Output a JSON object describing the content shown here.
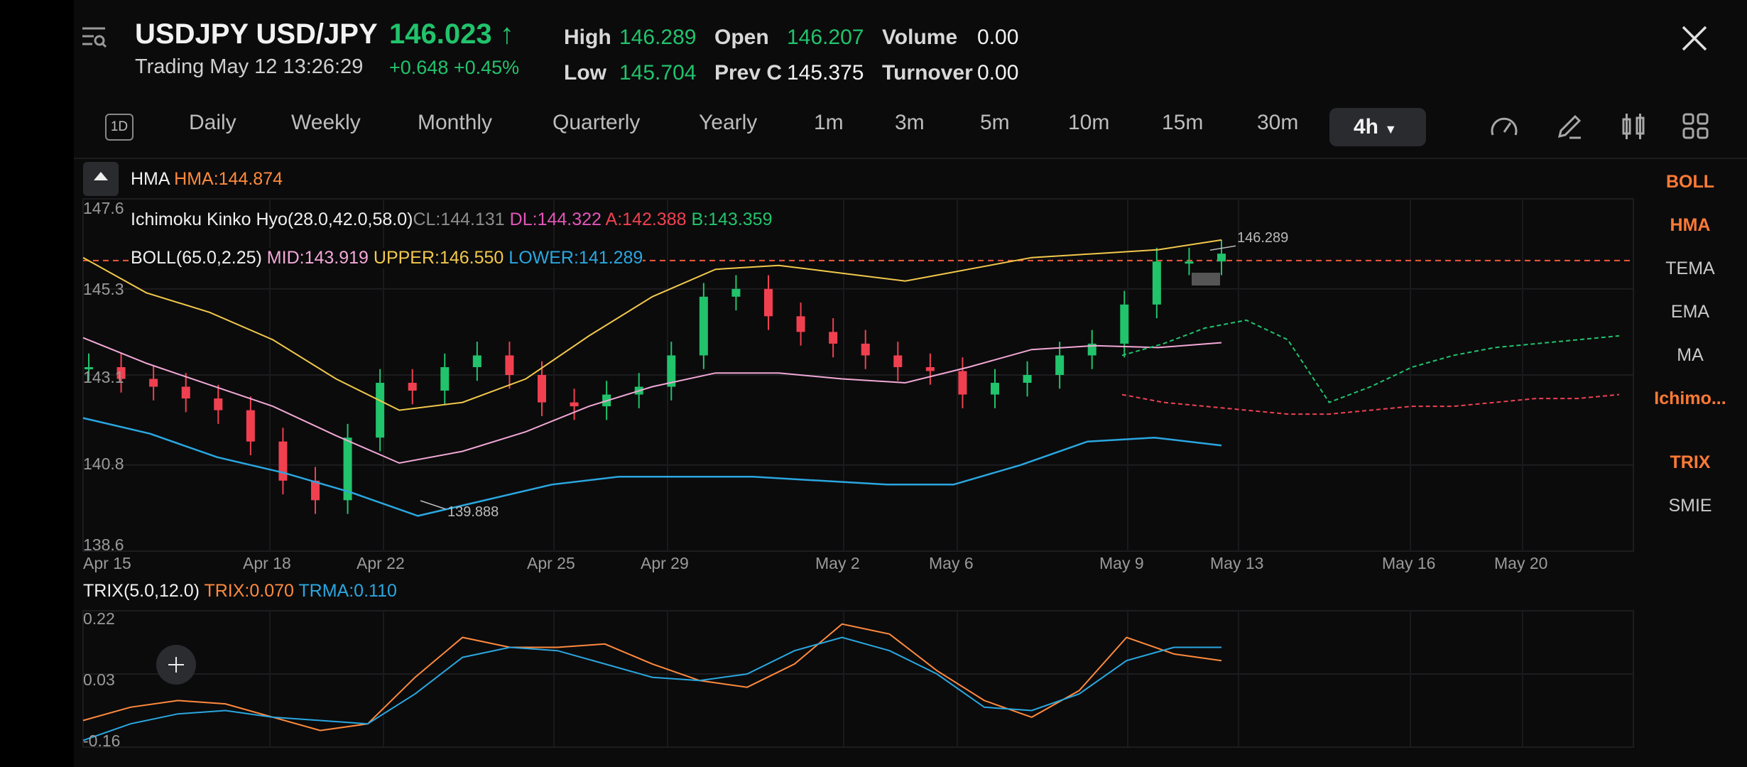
{
  "header": {
    "symbol": "USDJPY USD/JPY",
    "price": "146.023",
    "state": "Trading May 12 13:26:29",
    "change": "+0.648 +0.45%",
    "stats": {
      "high_label": "High",
      "high": "146.289",
      "low_label": "Low",
      "low": "145.704",
      "open_label": "Open",
      "open": "146.207",
      "prevc_label": "Prev C",
      "prevc": "145.375",
      "volume_label": "Volume",
      "volume": "0.00",
      "turnover_label": "Turnover",
      "turnover": "0.00"
    }
  },
  "toolbar": {
    "badge": "1D",
    "periods": [
      "Daily",
      "Weekly",
      "Monthly",
      "Quarterly",
      "Yearly",
      "1m",
      "3m",
      "5m",
      "10m",
      "15m",
      "30m"
    ],
    "active_period": "4h"
  },
  "indicators_side": [
    "BOLL",
    "HMA",
    "TEMA",
    "EMA",
    "MA",
    "Ichimo...",
    "TRIX",
    "SMIE"
  ],
  "legends": {
    "hma_name": "HMA",
    "hma_val": "HMA:144.874",
    "ichi_name": "Ichimoku Kinko Hyo(28.0,42.0,58.0)",
    "ichi_cl": "CL:144.131",
    "ichi_dl": "DL:144.322",
    "ichi_a": "A:142.388",
    "ichi_b": "B:143.359",
    "boll_name": "BOLL(65.0,2.25)",
    "boll_mid": "MID:143.919",
    "boll_upper": "UPPER:146.550",
    "boll_lower": "LOWER:141.289",
    "trix_name": "TRIX(5.0,12.0)",
    "trix_val": "TRIX:0.070",
    "trma_val": "TRMA:0.110"
  },
  "axes": {
    "main_y": [
      "147.6",
      "145.3",
      "143.1",
      "140.8",
      "138.6"
    ],
    "x_dates": [
      "Apr 15",
      "Apr 18",
      "Apr 22",
      "Apr 25",
      "Apr 29",
      "May 2",
      "May 6",
      "May 9",
      "May 13",
      "May 16",
      "May 20"
    ],
    "sub_y": [
      "0.22",
      "0.03",
      "-0.16"
    ],
    "high_mark": "146.289",
    "low_mark": "139.888"
  },
  "colors": {
    "up": "#21c36b",
    "down": "#f04050",
    "orange": "#ff8a3d",
    "yellow": "#f2c84b",
    "blue": "#2aa7e0",
    "pink": "#e255b8",
    "gray": "#8c8c8c"
  },
  "chart_data": [
    {
      "type": "candlestick",
      "title": "",
      "ylim": [
        138.6,
        147.6
      ],
      "x_ticks": [
        "Apr 15",
        "Apr 18",
        "Apr 22",
        "Apr 25",
        "Apr 29",
        "May 2",
        "May 6",
        "May 9",
        "May 13",
        "May 16",
        "May 20"
      ],
      "close_series": [
        143.3,
        143.0,
        142.8,
        142.5,
        142.2,
        141.4,
        140.4,
        139.9,
        141.5,
        142.9,
        142.7,
        143.3,
        143.6,
        143.1,
        142.4,
        142.3,
        142.6,
        142.8,
        143.6,
        145.1,
        145.3,
        144.6,
        144.2,
        143.9,
        143.6,
        143.3,
        143.2,
        142.6,
        142.9,
        143.1,
        143.6,
        143.9,
        144.9,
        146.0,
        146.0,
        146.2
      ],
      "upper_band": [
        146.1,
        145.2,
        144.7,
        144.0,
        143.0,
        142.2,
        142.4,
        143.0,
        144.1,
        145.1,
        145.8,
        145.9,
        145.7,
        145.5,
        145.8,
        146.1,
        146.2,
        146.3,
        146.55
      ],
      "lower_band": [
        142.0,
        141.6,
        141.0,
        140.6,
        140.1,
        139.5,
        139.9,
        140.3,
        140.5,
        140.5,
        140.5,
        140.4,
        140.3,
        140.3,
        140.8,
        141.4,
        141.5,
        141.3
      ],
      "high_mark": 146.289,
      "low_mark": 139.888
    },
    {
      "type": "line",
      "title": "",
      "ylim": [
        -0.19,
        0.22
      ],
      "series": [
        {
          "name": "TRIX",
          "values": [
            -0.11,
            -0.07,
            -0.05,
            -0.06,
            -0.1,
            -0.14,
            -0.12,
            0.02,
            0.14,
            0.11,
            0.11,
            0.12,
            0.06,
            0.01,
            -0.01,
            0.06,
            0.18,
            0.15,
            0.04,
            -0.05,
            -0.1,
            -0.02,
            0.14,
            0.09,
            0.07
          ]
        },
        {
          "name": "TRMA",
          "values": [
            -0.17,
            -0.12,
            -0.09,
            -0.08,
            -0.1,
            -0.11,
            -0.12,
            -0.03,
            0.08,
            0.11,
            0.1,
            0.06,
            0.02,
            0.01,
            0.03,
            0.1,
            0.14,
            0.1,
            0.03,
            -0.07,
            -0.08,
            -0.03,
            0.07,
            0.11,
            0.11
          ]
        }
      ]
    }
  ]
}
